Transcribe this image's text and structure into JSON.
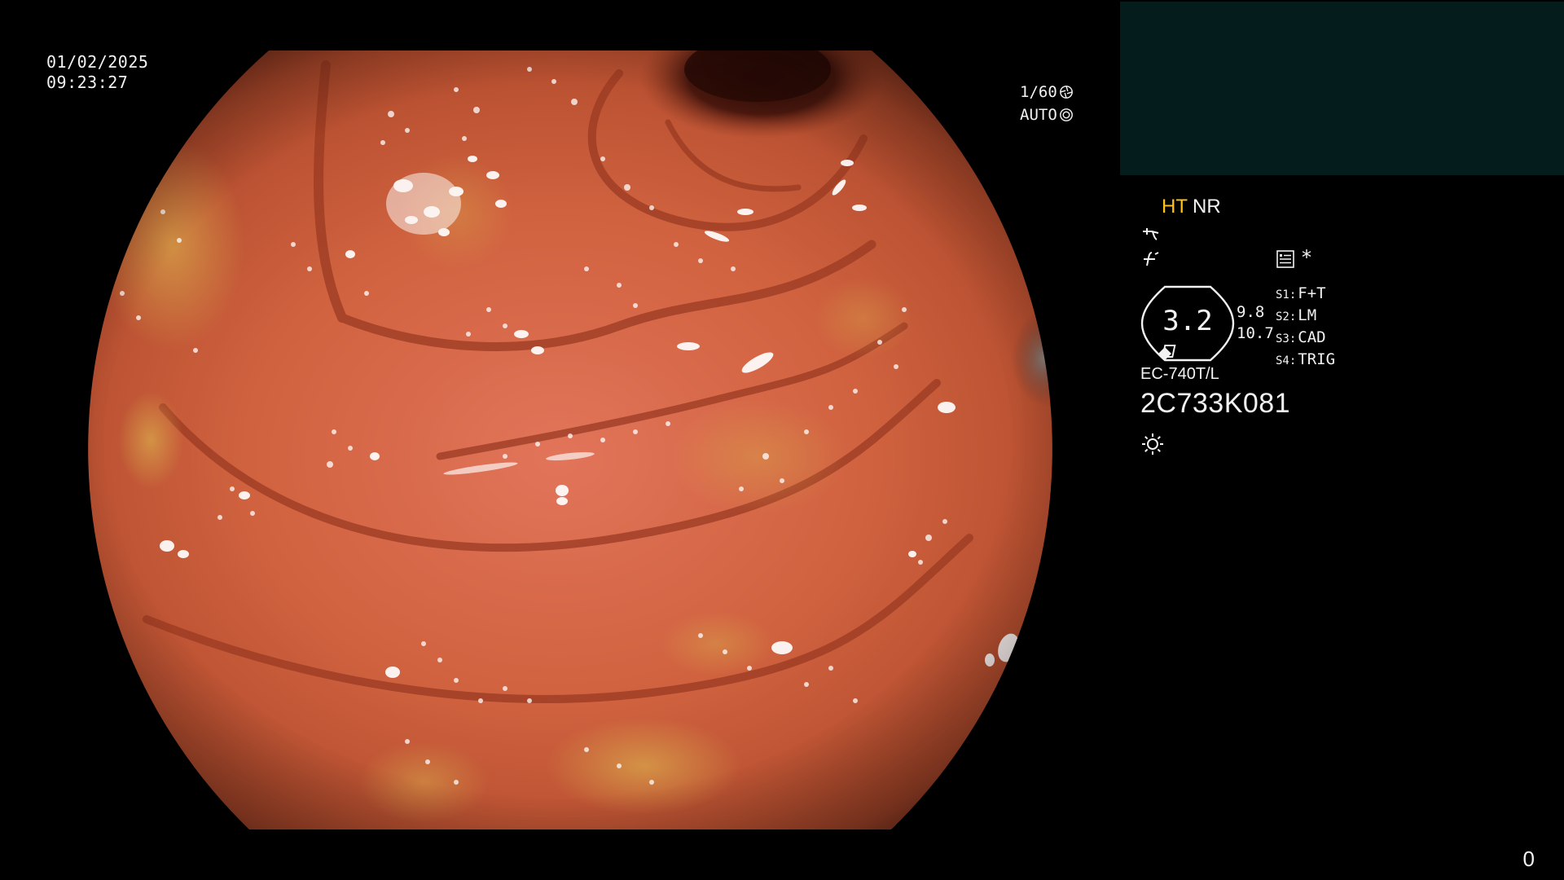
{
  "overlay": {
    "date": "01/02/2025",
    "time": "09:23:27",
    "shutter_speed": "1/60",
    "iris_mode": "AUTO"
  },
  "side_panel": {
    "mode_ht": "HT",
    "mode_nr": "NR",
    "dial_value": "3.2",
    "dial_side_top": "9.8",
    "dial_side_bottom": "10.7",
    "switches": [
      {
        "key": "S1:",
        "value": "F+T"
      },
      {
        "key": "S2:",
        "value": "LM"
      },
      {
        "key": "S3:",
        "value": "CAD"
      },
      {
        "key": "S4:",
        "value": "TRIG"
      }
    ],
    "scope_model": "EC-740T/L",
    "scope_serial": "2C733K081",
    "star": "*"
  },
  "frame_counter": "0",
  "colors": {
    "background": "#000000",
    "pip_panel": "#041c1c",
    "ht_label": "#ffc21a",
    "text": "#f2f2f2"
  },
  "icons": [
    "shutter-icon",
    "iris-icon",
    "enhancement-curve-icon",
    "structure-enhancement-icon",
    "menu-list-icon",
    "light-source-icon"
  ]
}
